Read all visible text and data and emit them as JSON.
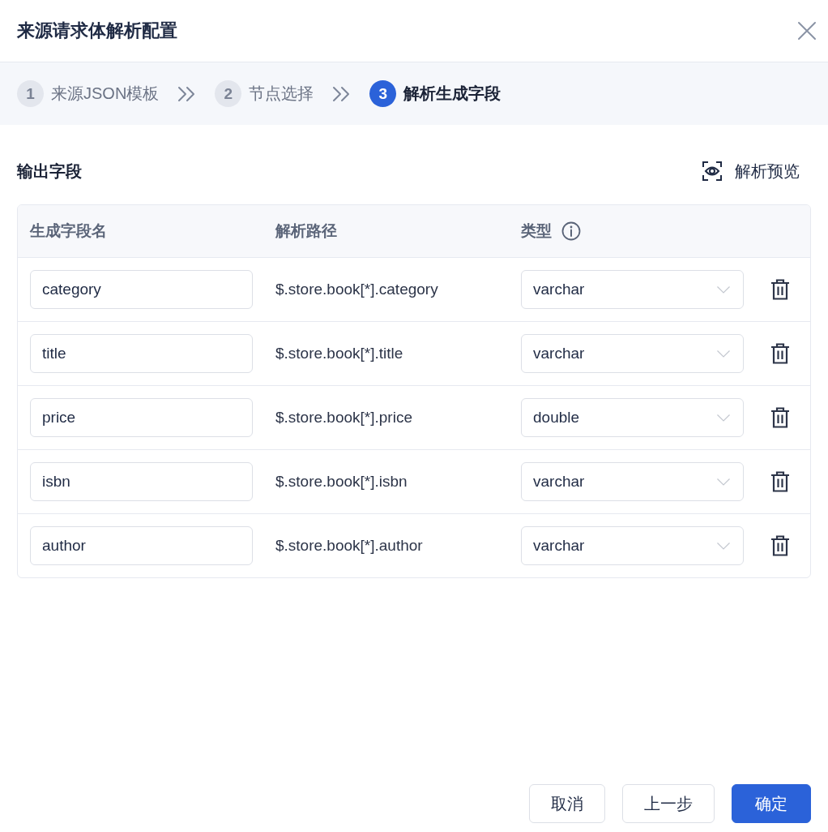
{
  "dialog": {
    "title": "来源请求体解析配置"
  },
  "steps": [
    {
      "number": "1",
      "label": "来源JSON模板",
      "selected": false
    },
    {
      "number": "2",
      "label": "节点选择",
      "selected": false
    },
    {
      "number": "3",
      "label": "解析生成字段",
      "selected": true
    }
  ],
  "section": {
    "title": "输出字段",
    "preview_button": "解析预览"
  },
  "table": {
    "columns": [
      {
        "label": "生成字段名",
        "kind": "plain"
      },
      {
        "label": "解析路径",
        "kind": "plain"
      },
      {
        "label": "类型",
        "kind": "hint"
      }
    ],
    "rows": [
      {
        "field_name": "category",
        "path": "$.store.book[*].category",
        "type": "varchar"
      },
      {
        "field_name": "title",
        "path": "$.store.book[*].title",
        "type": "varchar"
      },
      {
        "field_name": "price",
        "path": "$.store.book[*].price",
        "type": "double"
      },
      {
        "field_name": "isbn",
        "path": "$.store.book[*].isbn",
        "type": "varchar"
      },
      {
        "field_name": "author",
        "path": "$.store.book[*].author",
        "type": "varchar"
      }
    ]
  },
  "footer": {
    "buttons": [
      {
        "label": "取消",
        "kind": "default"
      },
      {
        "label": "上一步",
        "kind": "default"
      },
      {
        "label": "确定",
        "kind": "primary"
      }
    ]
  }
}
